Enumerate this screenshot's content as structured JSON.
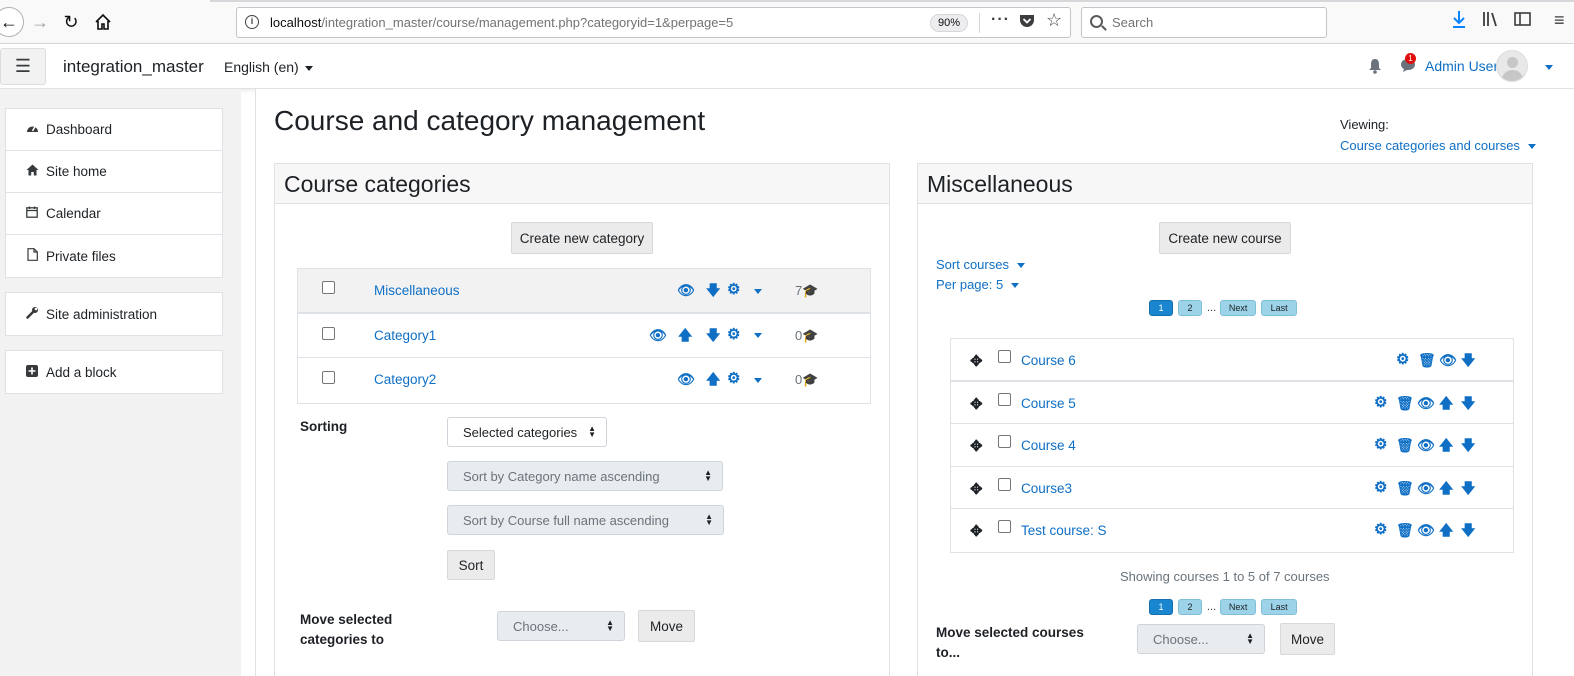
{
  "browser": {
    "url_host": "localhost",
    "url_path": "/integration_master/course/management.php?categoryid=1&perpage=5",
    "zoom": "90%",
    "search_placeholder": "Search"
  },
  "navbar": {
    "site_name": "integration_master",
    "language": "English (en)",
    "message_count": "1",
    "user_name": "Admin User"
  },
  "drawer": {
    "nav_items": [
      {
        "label": "Dashboard",
        "icon": "dashboard-icon"
      },
      {
        "label": "Site home",
        "icon": "home-icon"
      },
      {
        "label": "Calendar",
        "icon": "calendar-icon"
      },
      {
        "label": "Private files",
        "icon": "file-icon"
      }
    ],
    "admin_label": "Site administration",
    "add_block_label": "Add a block"
  },
  "page": {
    "title": "Course and category management",
    "viewing_label": "Viewing:",
    "viewing_value": "Course categories and courses"
  },
  "categories_panel": {
    "heading": "Course categories",
    "create_button": "Create new category",
    "rows": [
      {
        "name": "Miscellaneous",
        "count": "7"
      },
      {
        "name": "Category1",
        "count": "0"
      },
      {
        "name": "Category2",
        "count": "0"
      }
    ],
    "sorting_label": "Sorting",
    "sort_scope": "Selected categories",
    "sort_category_by": "Sort by Category name ascending",
    "sort_course_by": "Sort by Course full name ascending",
    "sort_button": "Sort",
    "move_label": "Move selected categories to",
    "move_choose": "Choose...",
    "move_button": "Move"
  },
  "courses_panel": {
    "heading": "Miscellaneous",
    "create_button": "Create new course",
    "sort_courses": "Sort courses",
    "per_page": "Per page: 5",
    "pager": {
      "page1": "1",
      "page2": "2",
      "ellipsis": "...",
      "next": "Next",
      "last": "Last"
    },
    "courses": [
      "Course 6",
      "Course 5",
      "Course 4",
      "Course3",
      "Test course: S"
    ],
    "showing": "Showing courses 1 to 5 of 7 courses",
    "move_label": "Move selected courses to...",
    "move_choose": "Choose...",
    "move_button": "Move"
  },
  "colors": {
    "link": "#0f6fc5",
    "pager_current": "#1a86cf",
    "pager_other": "#9cd3e9",
    "badge": "#e20c0c"
  }
}
